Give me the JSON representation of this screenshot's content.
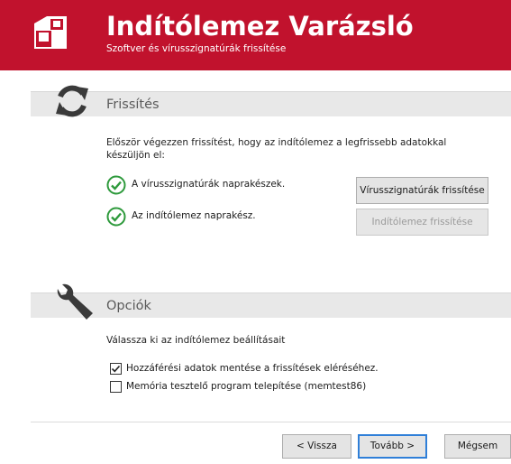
{
  "header": {
    "title": "Indítólemez Varázsló",
    "subtitle": "Szoftver és vírusszignatúrák frissítése",
    "logo_icon": "boot-disk-icon"
  },
  "update_section": {
    "title": "Frissítés",
    "icon": "refresh-icon",
    "intro": "Először végezzen frissítést, hogy az indítólemez a legfrissebb adatokkal készüljön el:",
    "items": [
      {
        "label": "A vírusszignatúrák naprakészek.",
        "button": "Vírusszignatúrák frissítése",
        "button_enabled": true
      },
      {
        "label": "Az indítólemez naprakész.",
        "button": "Indítólemez frissítése",
        "button_enabled": false
      }
    ]
  },
  "options_section": {
    "title": "Opciók",
    "icon": "wrench-icon",
    "intro": "Válassza ki az indítólemez beállításait",
    "options": [
      {
        "label": "Hozzáférési adatok mentése a frissítések eléréséhez.",
        "checked": true
      },
      {
        "label": "Memória tesztelő program telepítése (memtest86)",
        "checked": false
      }
    ]
  },
  "footer": {
    "back": "< Vissza",
    "next": "Tovább >",
    "cancel": "Mégsem"
  },
  "colors": {
    "brand": "#c1122d",
    "check_green": "#2e9a3c",
    "section_bg": "#e8e8e8"
  }
}
